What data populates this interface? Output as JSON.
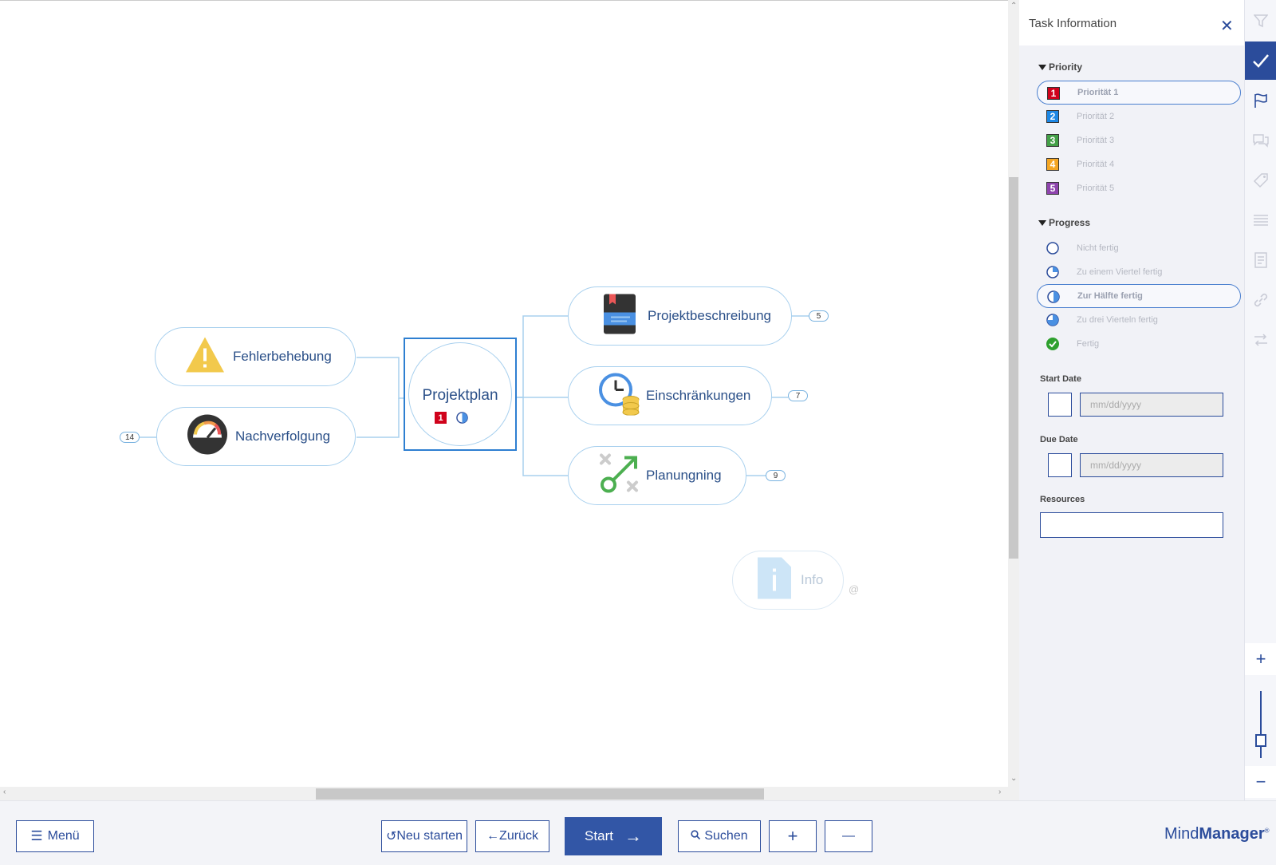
{
  "colors": {
    "accent": "#2b4c9b",
    "connector": "#a8d0ee",
    "priority1": "#d0021b",
    "priority2": "#1e88e5",
    "priority3": "#43a047",
    "priority4": "#f5a623",
    "priority5": "#8e44ad",
    "done": "#2ea02e"
  },
  "map": {
    "central": {
      "label": "Projektplan",
      "priority": "1"
    },
    "topics": [
      {
        "label": "Fehlerbehebung",
        "icon": "warning-icon"
      },
      {
        "label": "Nachverfolgung",
        "icon": "gauge-icon",
        "count": "14"
      },
      {
        "label": "Projektbeschreibung",
        "icon": "notebook-icon",
        "count": "5"
      },
      {
        "label": "Einschränkungen",
        "icon": "clock-coins-icon",
        "count": "7"
      },
      {
        "label": "Planungning",
        "icon": "strategy-icon",
        "count": "9"
      },
      {
        "label": "Info",
        "icon": "info-document-icon"
      }
    ]
  },
  "panel": {
    "title": "Task Information",
    "priority_heading": "Priority",
    "priorities": [
      {
        "num": "1",
        "label": "Priorität 1",
        "selected": true
      },
      {
        "num": "2",
        "label": "Priorität 2"
      },
      {
        "num": "3",
        "label": "Priorität 3"
      },
      {
        "num": "4",
        "label": "Priorität 4"
      },
      {
        "num": "5",
        "label": "Priorität 5"
      }
    ],
    "progress_heading": "Progress",
    "progress": [
      {
        "label": "Nicht fertig",
        "value": 0
      },
      {
        "label": "Zu einem Viertel fertig",
        "value": 0.25
      },
      {
        "label": "Zur Hälfte fertig",
        "value": 0.5,
        "selected": true
      },
      {
        "label": "Zu drei Vierteln fertig",
        "value": 0.75
      },
      {
        "label": "Fertig",
        "value": 1
      }
    ],
    "start_date_label": "Start Date",
    "due_date_label": "Due Date",
    "date_placeholder": "mm/dd/yyyy",
    "resources_label": "Resources"
  },
  "iconbar": [
    "filter-icon",
    "task-check-icon",
    "flag-icon",
    "comments-icon",
    "tag-icon",
    "list-icon",
    "notes-icon",
    "link-icon",
    "relationship-icon"
  ],
  "zoom": {
    "level": 0.3
  },
  "footer": {
    "menu": "Menü",
    "restart": "Neu starten",
    "back": "Zurück",
    "start": "Start",
    "search": "Suchen",
    "plus": "+",
    "minus": "—",
    "logo_light": "Mind",
    "logo_bold": "Manager",
    "logo_mark": "®"
  }
}
